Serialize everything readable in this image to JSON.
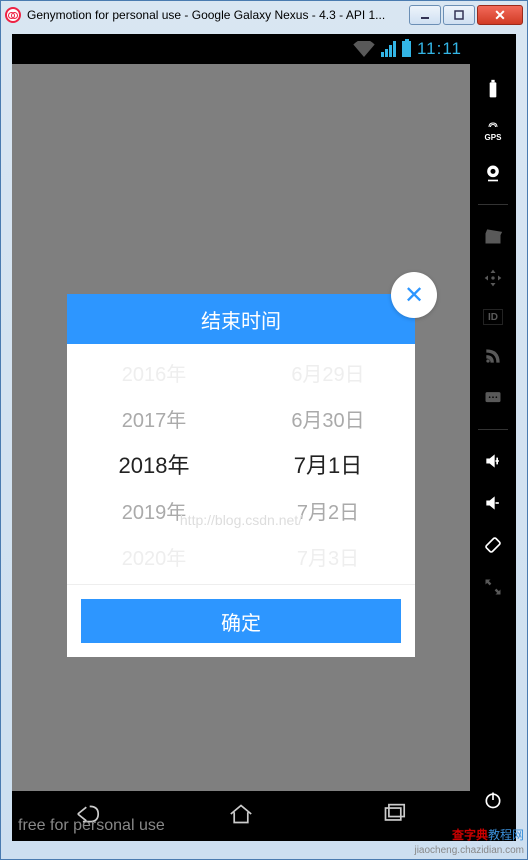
{
  "window": {
    "title": "Genymotion for personal use - Google Galaxy Nexus - 4.3 - API 1..."
  },
  "statusbar": {
    "time": "11:11"
  },
  "free_label": "free for personal use",
  "watermark": {
    "line1": "查字典",
    "line2": "教程网",
    "url": "jiaocheng.chazidian.com"
  },
  "blog_mark": "http://blog.csdn.net/",
  "dialog": {
    "title": "结束时间",
    "confirm": "确定",
    "year": {
      "options": [
        "2016年",
        "2017年",
        "2018年",
        "2019年",
        "2020年"
      ],
      "selected_index": 2
    },
    "md": {
      "options": [
        "6月29日",
        "6月30日",
        "7月1日",
        "7月2日",
        "7月3日"
      ],
      "selected_index": 2
    }
  },
  "side_icons": [
    "battery",
    "gps",
    "webcam",
    "clapper",
    "dpad",
    "id",
    "rss",
    "sms",
    "vol-up",
    "vol-down",
    "rotate",
    "fullscreen"
  ],
  "nav_icons": [
    "back",
    "home",
    "recent"
  ]
}
